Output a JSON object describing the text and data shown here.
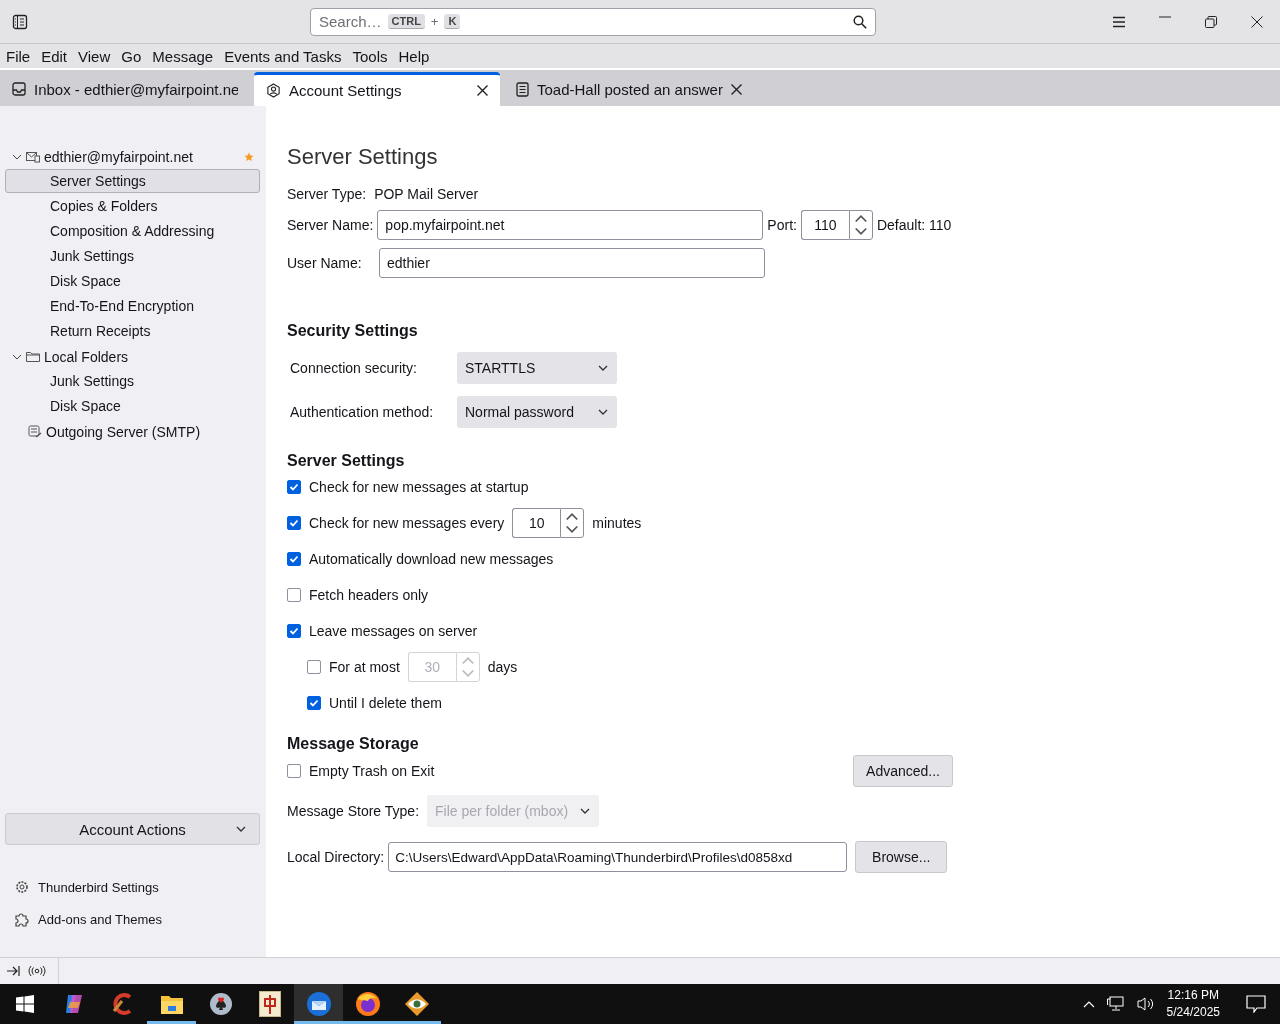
{
  "titlebar": {
    "search_placeholder": "Search…",
    "shortcut_keys": [
      "CTRL",
      "K"
    ],
    "shortcut_join": "+"
  },
  "menu": [
    "File",
    "Edit",
    "View",
    "Go",
    "Message",
    "Events and Tasks",
    "Tools",
    "Help"
  ],
  "tabs": [
    {
      "kind": "mail",
      "label": "Inbox - edthier@myfairpoint.ne",
      "selected": false,
      "closable": false
    },
    {
      "kind": "settings",
      "label": "Account Settings",
      "selected": true,
      "closable": true
    },
    {
      "kind": "article",
      "label": "Toad-Hall posted an answer",
      "selected": false,
      "closable": true
    }
  ],
  "sidebar": {
    "tree": [
      {
        "kind": "account",
        "label": "edthier@myfairpoint.net",
        "selected": false,
        "expanded": true,
        "starred": true,
        "children": [
          {
            "label": "Server Settings",
            "selected": true
          },
          {
            "label": "Copies & Folders",
            "selected": false
          },
          {
            "label": "Composition & Addressing",
            "selected": false
          },
          {
            "label": "Junk Settings",
            "selected": false
          },
          {
            "label": "Disk Space",
            "selected": false
          },
          {
            "label": "End-To-End Encryption",
            "selected": false
          },
          {
            "label": "Return Receipts",
            "selected": false
          }
        ]
      },
      {
        "kind": "folder",
        "label": "Local Folders",
        "selected": false,
        "expanded": true,
        "children": [
          {
            "label": "Junk Settings",
            "selected": false
          },
          {
            "label": "Disk Space",
            "selected": false
          }
        ]
      },
      {
        "kind": "server",
        "label": "Outgoing Server (SMTP)",
        "selected": false
      }
    ],
    "account_actions": "Account Actions",
    "links": [
      {
        "kind": "gear",
        "label": "Thunderbird Settings"
      },
      {
        "kind": "puzzle",
        "label": "Add-ons and Themes"
      }
    ]
  },
  "page": {
    "title": "Server Settings",
    "server_type_label": "Server Type:",
    "server_type": "POP Mail Server",
    "server_name_label": "Server Name:",
    "server_name": "pop.myfairpoint.net",
    "port_label": "Port:",
    "port": "110",
    "port_default": "Default: 110",
    "user_name_label": "User Name:",
    "user_name": "edthier",
    "security": {
      "heading": "Security Settings",
      "rows": [
        {
          "label": "Connection security:",
          "value": "STARTTLS"
        },
        {
          "label": "Authentication method:",
          "value": "Normal password"
        }
      ]
    },
    "settings": {
      "heading": "Server Settings",
      "items": [
        {
          "kind": "checkbox",
          "label": "Check for new messages at startup",
          "checked": true
        },
        {
          "kind": "number",
          "label": "Check for new messages every",
          "checked": true,
          "disabled": false,
          "value": "10",
          "suffix": "minutes"
        },
        {
          "kind": "checkbox",
          "label": "Automatically download new messages",
          "checked": true
        },
        {
          "kind": "checkbox",
          "label": "Fetch headers only",
          "checked": false
        },
        {
          "kind": "checkbox",
          "label": "Leave messages on server",
          "checked": true,
          "children": [
            {
              "kind": "number",
              "label": "For at most",
              "checked": false,
              "disabled": true,
              "value": "30",
              "suffix": "days"
            },
            {
              "kind": "checkbox",
              "label": "Until I delete them",
              "checked": true
            }
          ]
        }
      ]
    },
    "storage": {
      "heading": "Message Storage",
      "empty_trash": {
        "label": "Empty Trash on Exit",
        "checked": false
      },
      "advanced": "Advanced...",
      "store_type_label": "Message Store Type:",
      "store_type": "File per folder (mbox)",
      "store_type_disabled": true,
      "local_dir_label": "Local Directory:",
      "local_dir": "C:\\Users\\Edward\\AppData\\Roaming\\Thunderbird\\Profiles\\d0858xd",
      "browse": "Browse..."
    }
  },
  "taskbar": {
    "apps": [
      {
        "kind": "copilot",
        "running": false,
        "selected": false
      },
      {
        "kind": "cleaner",
        "running": false,
        "selected": false
      },
      {
        "kind": "files",
        "running": true,
        "selected": false
      },
      {
        "kind": "solitaire",
        "running": false,
        "selected": false
      },
      {
        "kind": "mahjong",
        "running": false,
        "selected": false
      },
      {
        "kind": "thunderbird",
        "running": true,
        "selected": true
      },
      {
        "kind": "firefox",
        "running": true,
        "selected": false
      },
      {
        "kind": "eye",
        "running": true,
        "selected": false
      }
    ],
    "time": "12:16 PM",
    "date": "5/24/2025"
  }
}
